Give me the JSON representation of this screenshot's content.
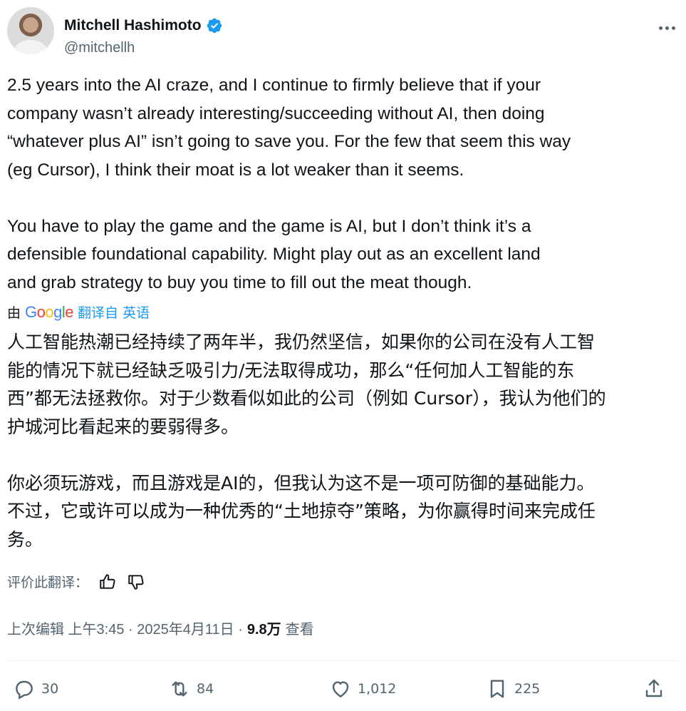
{
  "author": {
    "name": "Mitchell Hashimoto",
    "handle": "@mitchellh"
  },
  "tweet": {
    "text_en": "2.5 years into the AI craze, and I continue to firmly believe that if your\ncompany wasn’t already interesting/succeeding without AI, then doing\n“whatever plus AI” isn’t going to save you. For the few that seem this way\n(eg Cursor), I think their moat is a lot weaker than it seems.\n\nYou have to play the game and the game is AI, but I don’t think it’s a\ndefensible foundational capability. Might play out as an excellent land\nand grab strategy to buy you time to fill out the meat though.",
    "translated_prefix": "由",
    "translate_link": "翻译自 英语",
    "text_zh": "人工智能热潮已经持续了两年半，我仍然坚信，如果你的公司在没有人工智\n能的情况下就已经缺乏吸引力/无法取得成功，那么“任何加人工智能的东\n西”都无法拯救你。对于少数看似如此的公司（例如 Cursor），我认为他们的\n护城河比看起来的要弱得多。\n\n你必须玩游戏，而且游戏是AI的，但我认为这不是一项可防御的基础能力。\n不过，它或许可以成为一种优秀的“土地掠夺”策略，为你赢得时间来完成任\n务。",
    "rate_label": "评价此翻译："
  },
  "meta": {
    "edited_time": "上次编辑 上午3:45 · 2025年4月11日 ·",
    "views": "9.8万",
    "views_label": "查看"
  },
  "actions": {
    "replies": "30",
    "retweets": "84",
    "likes": "1,012",
    "bookmarks": "225"
  },
  "colors": {
    "accent": "#1d9bf0",
    "secondary_text": "#536471",
    "primary_text": "#0f1419"
  }
}
